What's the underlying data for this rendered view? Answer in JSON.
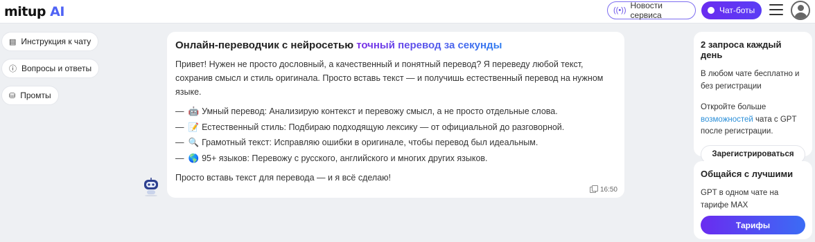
{
  "header": {
    "logo_main": "mitup",
    "logo_ai": "AI",
    "news_label": "Новости сервиса",
    "chatbots_label": "Чат-боты"
  },
  "sidebar": {
    "items": [
      {
        "label": "Инструкция к чату",
        "icon": "document-icon"
      },
      {
        "label": "Вопросы и ответы",
        "icon": "question-icon"
      },
      {
        "label": "Промты",
        "icon": "database-icon"
      }
    ]
  },
  "message": {
    "title_plain": "Онлайн-переводчик с нейросетью",
    "title_highlight": "точный перевод за секунды",
    "intro": "Привет! Нужен не просто дословный, а качественный и понятный перевод? Я переведу любой текст, сохранив смысл и стиль оригинала. Просто вставь текст — и получишь естественный перевод на нужном языке.",
    "bullets": [
      {
        "emoji": "🤖",
        "text": "Умный перевод: Анализирую контекст и перевожу смысл, а не просто отдельные слова."
      },
      {
        "emoji": "📝",
        "text": "Естественный стиль: Подбираю подходящую лексику — от официальной до разговорной."
      },
      {
        "emoji": "🔍",
        "text": "Грамотный текст: Исправляю ошибки в оригинале, чтобы перевод был идеальным."
      },
      {
        "emoji": "🌎",
        "text": "95+ языков: Перевожу с русского, английского и многих других языков."
      }
    ],
    "outro": "Просто вставь текст для перевода — и я всё сделаю!",
    "time": "16:50"
  },
  "cards": {
    "free": {
      "title": "2 запроса каждый день",
      "text1": "В любом чате бесплатно и без регистрации",
      "text2_before": "Откройте больше",
      "text2_link": "возможностей",
      "text2_after": "чата с GPT после регистрации.",
      "button": "Зарегистрироваться"
    },
    "premium": {
      "title": "Общайся с лучшими",
      "text": "GPT в одном чате на тарифе MAX",
      "button": "Тарифы"
    }
  },
  "colors": {
    "accent_purple": "#6a2cf0",
    "accent_blue": "#2f7df0",
    "link": "#2b8fd8",
    "background": "#eef0f3"
  }
}
